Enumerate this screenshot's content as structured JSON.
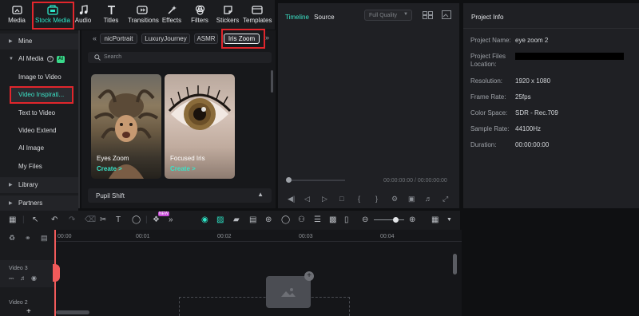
{
  "toolbar": {
    "items": [
      {
        "label": "Media",
        "icon": "media-icon"
      },
      {
        "label": "Stock Media",
        "icon": "stock-media-icon"
      },
      {
        "label": "Audio",
        "icon": "audio-icon"
      },
      {
        "label": "Titles",
        "icon": "titles-icon"
      },
      {
        "label": "Transitions",
        "icon": "transitions-icon"
      },
      {
        "label": "Effects",
        "icon": "effects-icon"
      },
      {
        "label": "Filters",
        "icon": "filters-icon"
      },
      {
        "label": "Stickers",
        "icon": "stickers-icon"
      },
      {
        "label": "Templates",
        "icon": "templates-icon"
      }
    ],
    "active": "Stock Media"
  },
  "sidebar": {
    "mine": "Mine",
    "ai_media": "AI Media",
    "ai_badge": "AI",
    "items": [
      "Image to Video",
      "Video Inspirati...",
      "Text to Video",
      "Video Extend",
      "AI Image",
      "My Files"
    ],
    "library": "Library",
    "partners": "Partners"
  },
  "content": {
    "tags": [
      "nicPortrait",
      "LuxuryJourney",
      "ASMR",
      "Iris Zoom"
    ],
    "search_placeholder": "Search",
    "cards": [
      {
        "title": "Eyes Zoom",
        "create": "Create >"
      },
      {
        "title": "Focused Iris",
        "create": "Create >"
      }
    ],
    "section": "Pupil Shift"
  },
  "player": {
    "tab_timeline": "Timeline",
    "tab_source": "Source",
    "quality": "Full Quality",
    "time_current": "00:00:00:00",
    "time_separator": "/",
    "time_total": "00:00:00:00"
  },
  "info": {
    "title": "Project Info",
    "rows": [
      {
        "label": "Project Name:",
        "value": "eye zoom 2"
      },
      {
        "label": "Project Files\nLocation:",
        "value": ""
      },
      {
        "label": "Resolution:",
        "value": "1920 x 1080"
      },
      {
        "label": "Frame Rate:",
        "value": "25fps"
      },
      {
        "label": "Color Space:",
        "value": "SDR - Rec.709"
      },
      {
        "label": "Sample Rate:",
        "value": "44100Hz"
      },
      {
        "label": "Duration:",
        "value": "00:00:00:00"
      }
    ]
  },
  "timeline": {
    "ruler": [
      "00:00",
      "00:01",
      "00:02",
      "00:03",
      "00:04"
    ],
    "tracks": [
      "Video 3",
      "Video 2"
    ],
    "new_badge": "NEW"
  },
  "colors": {
    "accent": "#2ee6c8",
    "highlight": "#e1262c",
    "playhead": "#f05a5a"
  }
}
